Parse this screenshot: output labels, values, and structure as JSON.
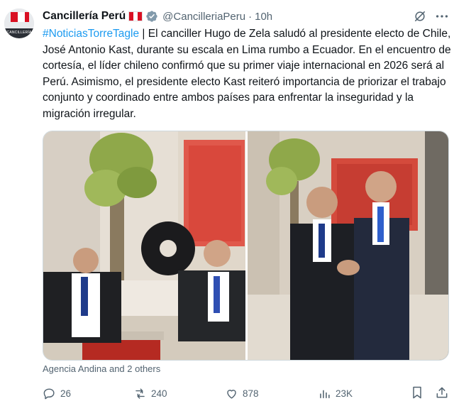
{
  "colors": {
    "accent": "#1d9bf0",
    "secondary_text": "#536471",
    "primary_text": "#0f1419",
    "flag_red": "#d91023"
  },
  "account": {
    "avatar_text": "CANCILLERÍA",
    "display_name": "Cancillería Perú",
    "flag_icon": "peru-flag-icon",
    "verified_icon": "verified-badge-icon",
    "handle": "@CancilleriaPeru",
    "separator": "·",
    "time": "10h"
  },
  "toolbar": {
    "grok_icon": "grok-icon",
    "more_icon": "more-options-icon"
  },
  "tweet": {
    "hashtag": "#NoticiasTorreTagle",
    "body": " | El canciller Hugo de Zela saludó al presidente electo de Chile, José Antonio Kast, durante su escala en Lima rumbo a Ecuador. En el encuentro de cortesía, el líder chileno confirmó que su primer viaje internacional en 2026 será al Perú. Asimismo, el presidente electo Kast reiteró importancia de priorizar el trabajo conjunto y coordinado entre ambos países para enfrentar la inseguridad y la migración irregular."
  },
  "media": {
    "caption": "Agencia Andina and 2 others"
  },
  "actions": {
    "replies": "26",
    "reposts": "240",
    "likes": "878",
    "views": "23K",
    "reply_icon": "reply-icon",
    "repost_icon": "repost-icon",
    "like_icon": "heart-icon",
    "views_icon": "views-chart-icon",
    "bookmark_icon": "bookmark-icon",
    "share_icon": "share-icon"
  }
}
